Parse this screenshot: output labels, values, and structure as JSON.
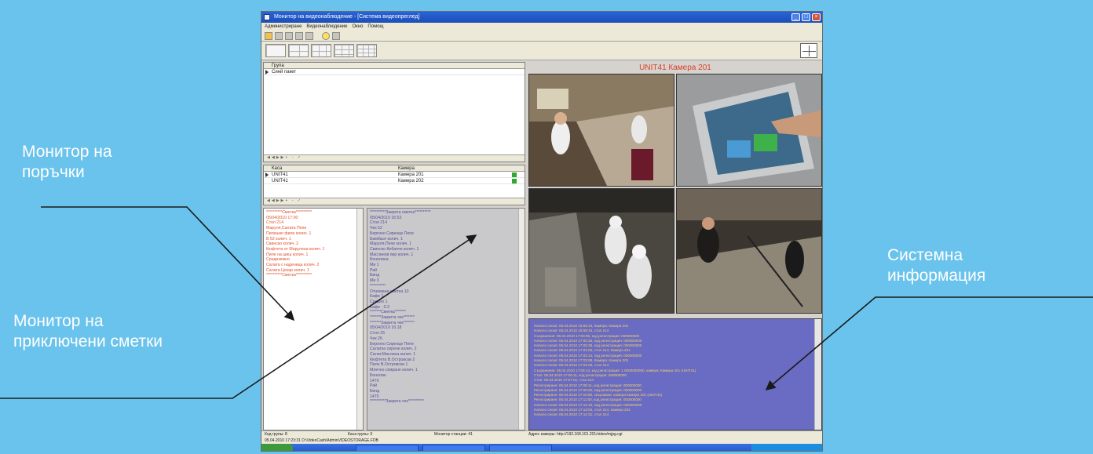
{
  "annotations": {
    "order_monitor": [
      "Монитор на",
      "поръчки"
    ],
    "closed_bills_monitor": [
      "Монитор на",
      "приключени сметки"
    ],
    "system_info": [
      "Системна",
      "информация"
    ]
  },
  "app": {
    "title": "Монитор на видеонаблюдение - [Система видеопреглед]",
    "menu": [
      "Администриране",
      "Видеонаблюдение",
      "Окно",
      "Помощ"
    ]
  },
  "groups_grid": {
    "header": "Група",
    "rows": [
      "Синй пакет"
    ]
  },
  "cashier_grid": {
    "headers": [
      "Каса",
      "Камера"
    ],
    "rows": [
      {
        "cashier": "UNIT41",
        "camera": "Камера 201"
      },
      {
        "cashier": "UNIT41",
        "camera": "Камера 202"
      }
    ]
  },
  "receipts": {
    "open_order": [
      "**********Сметка**********",
      "05/04/2010 17:00",
      "Стол 214",
      "Маруля,Салата Пепе",
      "Пилешко филе колич. 1",
      "В 52 колич. 1",
      "Свинско колич. 2",
      "Кюфтета от Маруляна колич. 1",
      "Пиле на шиш колич. 1",
      "Средиземно",
      "Салата с наденица колич. 2",
      "Салата Цезар колич. 1",
      "**********Сметка**********"
    ],
    "closed_bills": [
      "**********Закрита сметка**********",
      "05/04/2010 16:53",
      "Стол 214",
      "Чек 52",
      "Бергино Сиренце Пепе",
      "Бамбасе колич. 1",
      "Маруля,Пепе колич. 1",
      "Свинско Кебапче колич. 1",
      "Маслинов пир колич. 1",
      "Бонолина",
      "Ми 1",
      "Рай",
      "Бинд",
      "Ми 3",
      "**********",
      "Отнемане сметка 10",
      "Кафе 1",
      "Средно 1",
      "Кафе - 0.3",
      "*******Сметка*******",
      "*******Закрита чек*******",
      "*******Закрита чек*******",
      "05/04/2010 16:18",
      "Стол 25",
      "Чек 26",
      "Бергино Сиренце Пепе",
      "Салатка сирене колич. 2",
      "Салат,Маслина колич. 1",
      "Кюфтета В.Островски 2",
      "Пиле В.Островски 1",
      "Млечно спиране колич. 1",
      "Бонолин",
      "1470",
      "Рай",
      "Бинд",
      "1470",
      "**********Закрита чек**********"
    ]
  },
  "camera": {
    "title": "UNIT41 Камера 201"
  },
  "system_log": [
    "Начало сесия: 05.04.2010 16:59:16, Камера: Камера 201",
    "Начало сесия: 05.04.2010 16:59:16, стол 214",
    "Съхранение: 05.04.2010 17:00:05, код регистрация: 000000000",
    "Начало сесия: 05.04.2010 17:00:25, код регистрация: 000000000",
    "Начало сесия: 05.04.2010 17:00:38, код регистрация: 000000000",
    "Начало сесия: 05.04.2010 17:01:05, стол 214, Камера 201",
    "Начало сесия: 05.04.2010 17:02:14, код регистрация: 000000000",
    "Начало сесия: 05.04.2010 17:03:08, Камера: Камера 201",
    "Начало сесия: 05.04.2010 17:04:20, стол 214",
    "Съхранение: 05.04.2010 17:05:14, код регистрация: 1 0000000000, камера: Камера 201 (UNIT41)",
    "Стоп: 05.04.2010 17:06:11, код регистрация: 000000000",
    "Стоп: 05.04.2010 17:07:02, стол 214",
    "Регистриране: 05.04.2010 17:08:11, код регистрация: 000000000",
    "Регистриране: 05.04.2010 17:09:25, код регистрация: 000000000",
    "Регистриране: 05.04.2010 17:10:06, свързване: камера Камера 201 (UNIT41)",
    "Регистриране: 05.04.2010 17:11:00, код регистрация: 000000000",
    "Начало сесия: 05.04.2010 17:12:15, код регистрация: 000000000",
    "Начало сесия: 05.04.2010 17:13:04, стол 214, Камера 201",
    "Начало сесия: 05.04.2010 17:14:31, стол 214"
  ],
  "status": {
    "groups": "Код групы: 8",
    "cashiers": "Каса групы: 0",
    "monitor": "Монитор станции: 41",
    "camera_address": "Адрес камеры: http://192.168.101.201/video/mjpg.cgi",
    "path": "05.04.2010 17:23:31   D:\\VideoCash\\AdminVIDEOSTORAGE.FDB"
  },
  "colors": {
    "background": "#69c3ec",
    "order_text": "#e0502a",
    "closed_text": "#5a4c98",
    "camera_title": "#d9422a",
    "log_background": "#6a6bc2",
    "log_text": "#f4d26a"
  }
}
